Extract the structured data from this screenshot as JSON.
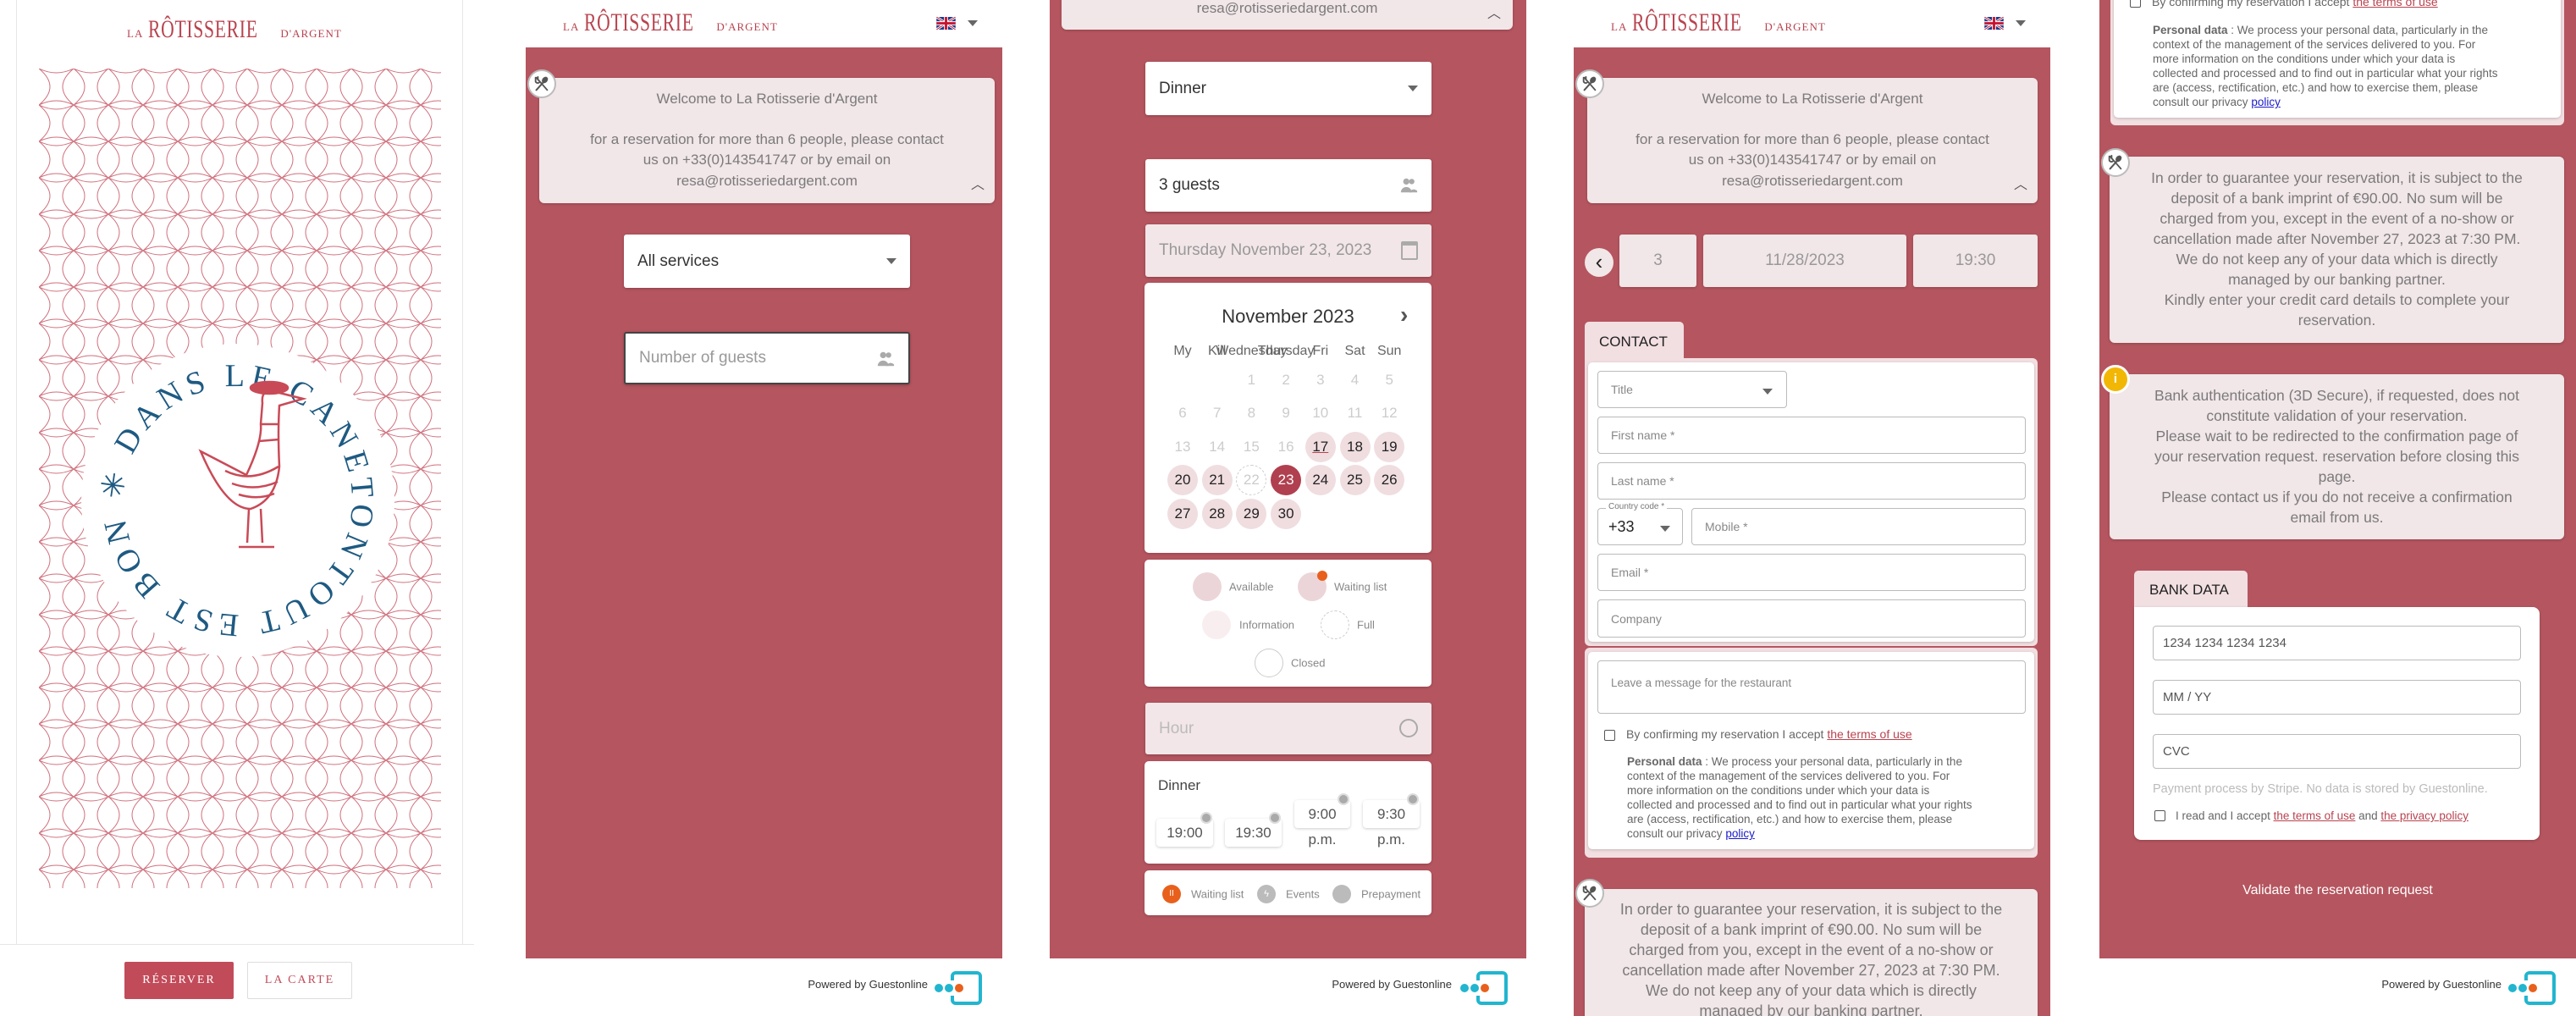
{
  "logo": {
    "prefix": "LA",
    "main": "RÔTISSERIE",
    "suffix": "D'ARGENT"
  },
  "language": {
    "icon": "uk-flag-icon"
  },
  "colors": {
    "brand_red": "#b5555f",
    "accent": "#c24b5a",
    "selected_day": "#b0404f",
    "info_bg": "#f1e6e8",
    "waiting": "#e8601c",
    "guestonline_cyan": "#22b5cf"
  },
  "landing": {
    "emblem_text": "TOUT EST BON ✳ DANS LE CANETON ✳",
    "reserve_button": "RÉSERVER",
    "menu_button": "LA CARTE"
  },
  "welcome": {
    "title": "Welcome to La Rotisserie d'Argent",
    "lines": [
      "for a reservation for more than 6 people, please contact",
      "us on +33(0)143541747 or by email on",
      "resa@rotisseriedargent.com"
    ]
  },
  "step1": {
    "service_select": "All services",
    "guests_placeholder": "Number of guests"
  },
  "step2": {
    "service_select": "Dinner",
    "guests_value": "3 guests",
    "date_value": "Thursday November 23, 2023",
    "calendar": {
      "month": "November 2023",
      "weekdays": [
        "My",
        "Kill",
        "Wednesday",
        "Thursday",
        "Fri",
        "Sat",
        "Sun"
      ],
      "first_weekday_index": 2,
      "days_in_month": 30,
      "unavailable_days": [
        1,
        2,
        3,
        4,
        5,
        6,
        7,
        8,
        9,
        10,
        11,
        12,
        13,
        14,
        15,
        16
      ],
      "today": 17,
      "full_days": [
        22
      ],
      "selected_day": 23
    },
    "legend": {
      "available": "Available",
      "waiting_list": "Waiting list",
      "information": "Information",
      "full": "Full",
      "closed": "Closed"
    },
    "hour_placeholder": "Hour",
    "service_name": "Dinner",
    "slots": [
      {
        "time": "19:00",
        "suffix": ""
      },
      {
        "time": "19:30",
        "suffix": ""
      },
      {
        "time": "9:00",
        "suffix": "p.m."
      },
      {
        "time": "9:30",
        "suffix": "p.m."
      }
    ],
    "icon_legend": {
      "waiting_list": "Waiting list",
      "events": "Events",
      "prepayment": "Prepayment"
    }
  },
  "step3": {
    "summary": {
      "guests": "3",
      "date": "11/28/2023",
      "time": "19:30"
    },
    "contact_tab": "CONTACT",
    "fields": {
      "title": "Title",
      "first_name": "First name  *",
      "last_name": "Last name  *",
      "country_code_label": "Country code  *",
      "country_code_value": "+33",
      "mobile": "Mobile  *",
      "email": "Email  *",
      "company": "Company",
      "message": "Leave a message for the restaurant"
    },
    "terms_prefix": "By confirming my reservation I accept ",
    "terms_link": "the terms of use",
    "personal_data_label": "Personal data",
    "personal_data_lines": [
      " : We process your personal data, particularly in the",
      "context of the management of the services delivered to you. For",
      "more information on the conditions under which your data is",
      "collected and processed and to find out in particular what your rights",
      "are (access, rectification, etc.) and how to exercise them, please",
      "consult our privacy "
    ],
    "privacy_link": "policy"
  },
  "deposit": {
    "lines": [
      "In order to guarantee your reservation, it is subject to the",
      "deposit of a bank imprint of €90.00. No sum will be",
      "charged from you, except in the event of a no-show or",
      "cancellation made after November 27, 2023 at 7:30 PM.",
      "We do not keep any of your data which is directly",
      "managed by our banking partner.",
      "Kindly enter your credit card details to complete your",
      "reservation."
    ]
  },
  "bank_info": {
    "lines": [
      "Bank authentication (3D Secure), if requested, does not",
      "constitute validation of your reservation.",
      "Please wait to be redirected to the confirmation page of",
      "your reservation request. reservation before closing this",
      "page.",
      "Please contact us if you do not receive a confirmation",
      "email from us."
    ]
  },
  "bank": {
    "tab": "BANK DATA",
    "card_number": "1234 1234 1234 1234",
    "expiry": "MM / YY",
    "cvc": "CVC",
    "stripe_note": "Payment process by Stripe. No data is stored by Guestonline.",
    "accept_prefix": "I read and I accept ",
    "terms_link": "the terms of use",
    "and": " and ",
    "privacy_link": "the privacy policy",
    "validate": "Validate the reservation request"
  },
  "footer": {
    "powered_by": "Powered by Guestonline"
  }
}
